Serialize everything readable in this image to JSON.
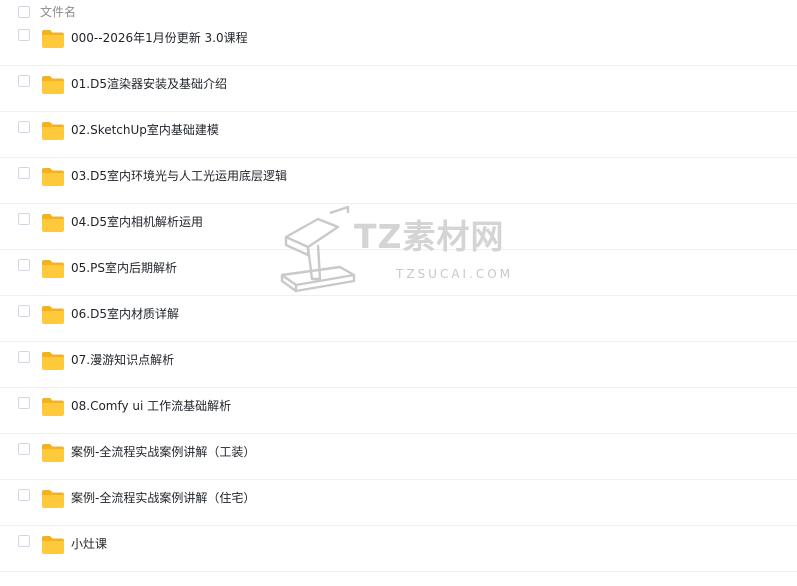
{
  "header": {
    "name_column_label": "文件名"
  },
  "rows": [
    {
      "name": "000--2026年1月份更新 3.0课程",
      "icon": "folder-icon"
    },
    {
      "name": "01.D5渲染器安装及基础介绍",
      "icon": "folder-icon"
    },
    {
      "name": "02.SketchUp室内基础建模",
      "icon": "folder-icon"
    },
    {
      "name": "03.D5室内环境光与人工光运用底层逻辑",
      "icon": "folder-icon"
    },
    {
      "name": "04.D5室内相机解析运用",
      "icon": "folder-icon"
    },
    {
      "name": "05.PS室内后期解析",
      "icon": "folder-icon"
    },
    {
      "name": "06.D5室内材质详解",
      "icon": "folder-icon"
    },
    {
      "name": "07.漫游知识点解析",
      "icon": "folder-icon"
    },
    {
      "name": "08.Comfy ui 工作流基础解析",
      "icon": "folder-icon"
    },
    {
      "name": "案例-全流程实战案例讲解（工装）",
      "icon": "folder-icon"
    },
    {
      "name": "案例-全流程实战案例讲解（住宅）",
      "icon": "folder-icon"
    },
    {
      "name": "小灶课",
      "icon": "folder-icon"
    }
  ],
  "watermark": {
    "title": "TZ素材网",
    "domain": "TZSUCAI.COM"
  },
  "colors": {
    "folder_body": "#ffc93c",
    "folder_tab": "#f5b21f",
    "divider": "#eef0f3",
    "text": "#1f2329",
    "muted": "#8c8c8c",
    "watermark": "#d4d4d4"
  }
}
